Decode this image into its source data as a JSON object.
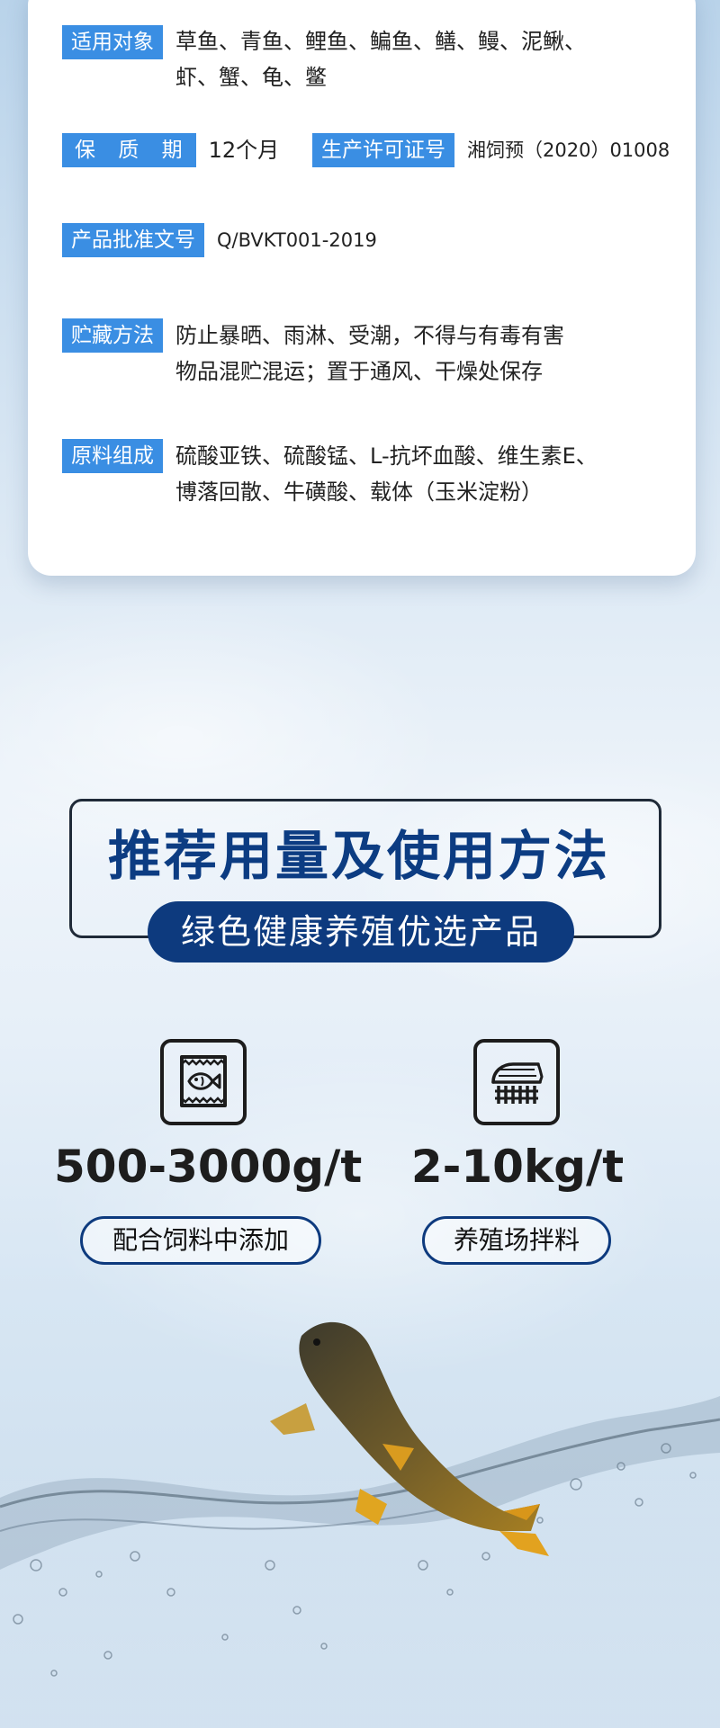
{
  "spec": {
    "suitable": {
      "label": "适用对象",
      "value_line1": "草鱼、青鱼、鲤鱼、鳊鱼、鳝、鳗、泥鳅、",
      "value_line2": "虾、蟹、龟、鳖"
    },
    "shelf_life": {
      "label": "保 质 期",
      "value": "12个月"
    },
    "license": {
      "label": "生产许可证号",
      "value": "湘饲预（2020）01008"
    },
    "approval": {
      "label": "产品批准文号",
      "value": "Q/BVKT001-2019"
    },
    "storage": {
      "label": "贮藏方法",
      "value_line1": "防止暴晒、雨淋、受潮，不得与有毒有害",
      "value_line2": "物品混贮混运；置于通风、干燥处保存"
    },
    "ingredients": {
      "label": "原料组成",
      "value_line1": "硫酸亚铁、硫酸锰、L-抗坏血酸、维生素E、",
      "value_line2": "博落回散、牛磺酸、载体（玉米淀粉）"
    }
  },
  "usage": {
    "title": "推荐用量及使用方法",
    "subtitle": "绿色健康养殖优选产品",
    "items": [
      {
        "icon": "feed-bag-fish-icon",
        "dose": "500-3000g/t",
        "method": "配合饲料中添加"
      },
      {
        "icon": "farm-fence-icon",
        "dose": "2-10kg/t",
        "method": "养殖场拌料"
      }
    ]
  },
  "colors": {
    "tag_blue": "#3a8ee3",
    "navy": "#0d3a7e",
    "title_blue": "#0c3c82"
  }
}
